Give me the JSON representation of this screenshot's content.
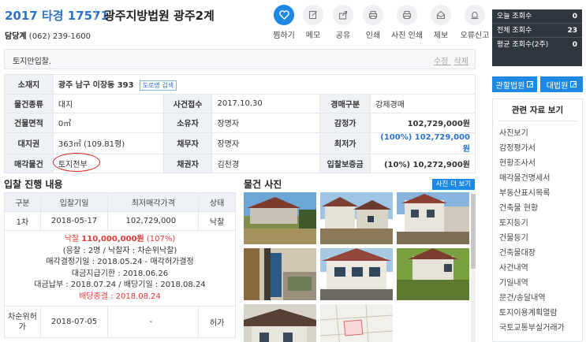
{
  "header": {
    "case_number": "2017 타경 17571",
    "court": "광주지방법원 광주2계",
    "dept_label": "담당계",
    "dept_phone": "(062) 239-1600"
  },
  "toolbar": [
    {
      "label": "찜하기",
      "icon": "heart-icon"
    },
    {
      "label": "메모",
      "icon": "memo-icon"
    },
    {
      "label": "공유",
      "icon": "share-icon"
    },
    {
      "label": "인쇄",
      "icon": "print-icon"
    },
    {
      "label": "사진 인쇄",
      "icon": "photo-print-icon"
    },
    {
      "label": "제보",
      "icon": "report-icon"
    },
    {
      "label": "오류신고",
      "icon": "error-report-icon"
    }
  ],
  "memo": {
    "text": "토지만입찰.",
    "edit_label": "수정",
    "delete_label": "삭제"
  },
  "info": {
    "address_label": "소재지",
    "address": "광주 남구 이장동 393",
    "road_search": "도로명 검색",
    "type_label": "물건종류",
    "type": "대지",
    "filed_label": "사건접수",
    "filed": "2017.10.30",
    "auction_kind_label": "경매구분",
    "auction_kind": "강제경매",
    "bldg_area_label": "건물면적",
    "bldg_area": "0㎡",
    "owner_label": "소유자",
    "owner": "장명자",
    "appraisal_label": "감정가",
    "appraisal": "102,729,000원",
    "land_right_label": "대지권",
    "land_right": "363㎡ (109.81평)",
    "debtor_label": "채무자",
    "debtor": "장명자",
    "min_price_label": "최저가",
    "min_price": "(100%) 102,729,000원",
    "sale_object_label": "매각물건",
    "sale_object": "토지전부",
    "creditor_label": "채권자",
    "creditor": "김천경",
    "deposit_label": "입찰보증금",
    "deposit": "(10%) 10,272,900원"
  },
  "bid_history": {
    "title": "입찰 진행 내용",
    "headers": [
      "구분",
      "입찰기일",
      "최저매각가격",
      "상태"
    ],
    "row1": [
      "1차",
      "2018-05-17",
      "102,729,000",
      "낙찰"
    ],
    "winning": {
      "prefix": "낙찰 ",
      "amount": "110,000,000원",
      "pct": " (107%)"
    },
    "detail_lines": [
      "(응찰 : 2명 / 낙찰자 : 차순위낙찰)",
      "매각결정기일 : 2018.05.24 - 매각허가결정",
      "대금지급기한 : 2018.06.26",
      "대금납부 : 2018.07.24 / 배당기일 : 2018.08.24"
    ],
    "dividend_end": "배당종결 : 2018.08.24",
    "row2": [
      "차순위허가",
      "2018-07-05",
      "-",
      "허가"
    ]
  },
  "photos": {
    "title": "물건 사진",
    "more_label": "사진 더 보기"
  },
  "stats": {
    "today_label": "오늘 조회수",
    "today": "0",
    "total_label": "전체 조회수",
    "total": "23",
    "avg_label": "평균 조회수(2주)",
    "avg": "0"
  },
  "site_buttons": {
    "court_site": "관할법원",
    "supreme_site": "대법원"
  },
  "related": {
    "title": "관련 자료 보기",
    "items": [
      "사진보기",
      "감정평가서",
      "현황조사서",
      "매각물건명세서",
      "부동산표시목록",
      "건축물 현황",
      "토지등기",
      "건물등기",
      "건축물대장",
      "사건내역",
      "기일내역",
      "문건/송달내역",
      "토지이용계획열람",
      "국토교통부실거래가"
    ]
  }
}
